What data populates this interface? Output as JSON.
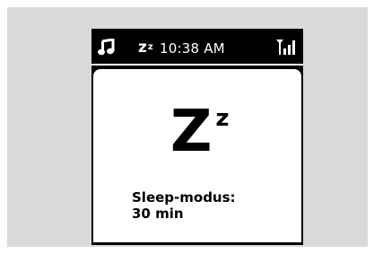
{
  "status_bar": {
    "music_icon": "music-note-icon",
    "sleep_indicator": "z",
    "sleep_indicator_sup": "z",
    "time": "10:38 AM",
    "signal_icon": "wifi-signal-icon"
  },
  "screen": {
    "icon_main": "Z",
    "icon_sup": "z",
    "message_line1": "Sleep-modus:",
    "message_line2": "30 min"
  },
  "colors": {
    "background": "#d9d9d9",
    "device": "#000000",
    "screen": "#ffffff"
  }
}
